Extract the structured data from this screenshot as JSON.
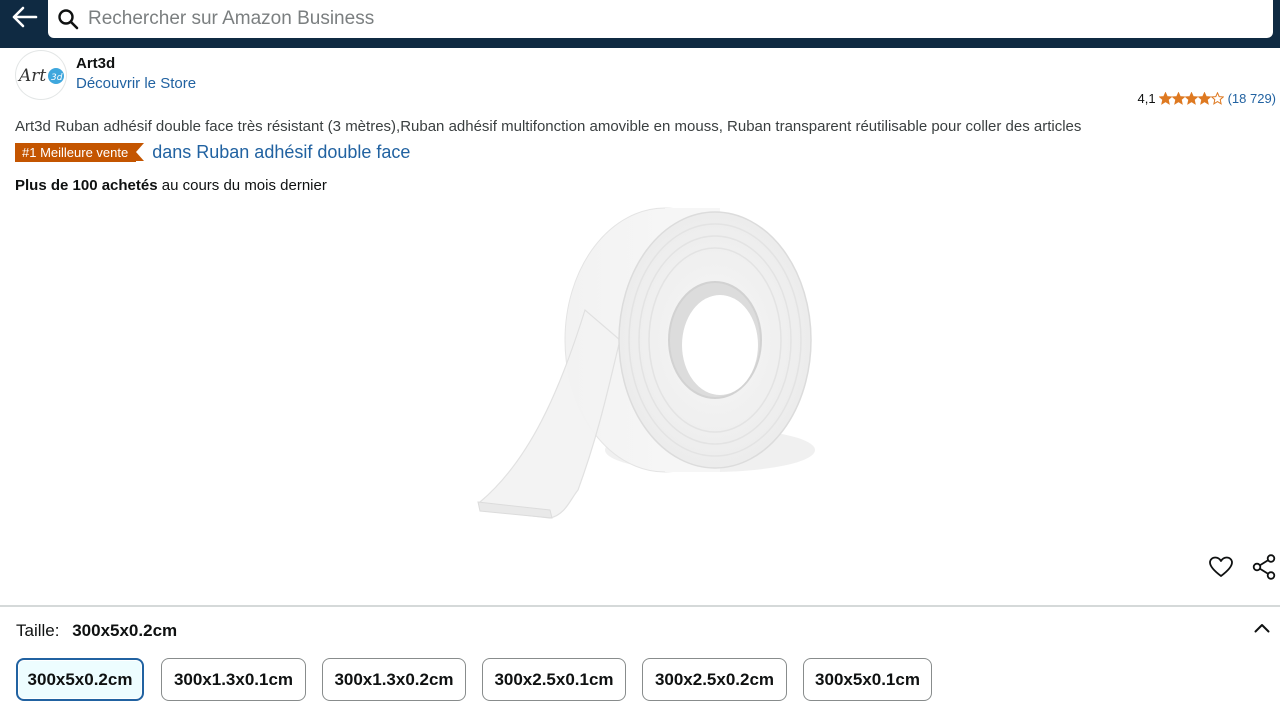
{
  "search": {
    "placeholder": "Rechercher sur Amazon Business"
  },
  "brand": {
    "name": "Art3d",
    "store_link": "Découvrir le Store",
    "logo_text": "Art",
    "logo_badge": "3d"
  },
  "rating": {
    "value": "4,1",
    "stars": 4.1,
    "count": "(18 729)"
  },
  "product": {
    "title": "Art3d Ruban adhésif double face très résistant (3 mètres),Ruban adhésif multifonction amovible en mouss, Ruban transparent réutilisable pour coller des articles",
    "badge": "#1 Meilleure vente",
    "badge_category": "dans Ruban adhésif double face",
    "bought_bold": "Plus de 100 achetés",
    "bought_rest": " au cours du mois dernier"
  },
  "size": {
    "label": "Taille:",
    "selected": "300x5x0.2cm",
    "options": [
      "300x5x0.2cm",
      "300x1.3x0.1cm",
      "300x1.3x0.2cm",
      "300x2.5x0.1cm",
      "300x2.5x0.2cm",
      "300x5x0.1cm"
    ]
  },
  "colors": {
    "header": "#0f2a42",
    "link": "#2162a1",
    "badge": "#c45500",
    "star": "#de7921"
  }
}
